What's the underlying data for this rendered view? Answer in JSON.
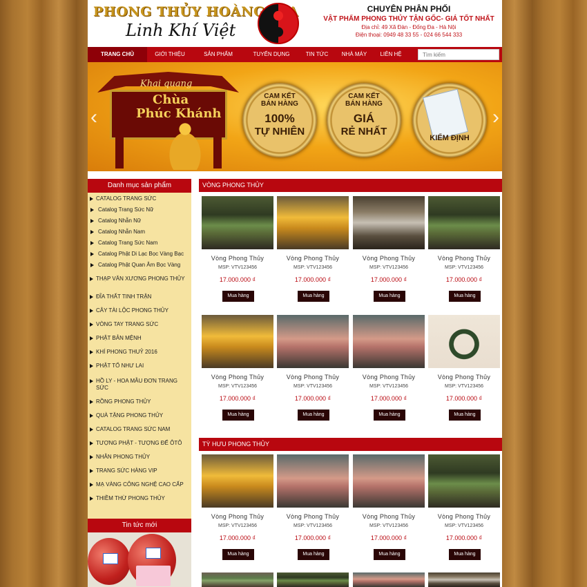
{
  "header": {
    "logo_main": "PHONG THỦY HOÀNG GIA",
    "logo_sub": "Linh Khí Việt",
    "title": "CHUYÊN PHÂN PHỐI",
    "slogan": "VẬT PHẨM PHONG THỦY TẬN GỐC- GIÁ TỐT NHẤT",
    "address": "Địa chỉ: 49 Xã Đàn - Đống Đa - Hà Nội",
    "phone": "Điện thoại: 0949 48 33 55 - 024 66 544 333"
  },
  "nav": {
    "items": [
      {
        "label": "TRANG CHỦ"
      },
      {
        "label": "GIỚI THIỆU"
      },
      {
        "label": "SẢN PHẨM"
      },
      {
        "label": "TUYỂN DỤNG"
      },
      {
        "label": "TIN TỨC"
      },
      {
        "label": "NHÀ MÁY"
      },
      {
        "label": "LIÊN HỆ"
      }
    ],
    "search_placeholder": "Tìm kiếm"
  },
  "banner": {
    "title_1": "Khai quang",
    "title_2": "Chùa",
    "title_3": "Phúc Khánh",
    "medal_1": [
      "CAM KẾT",
      "BÁN HÀNG",
      "100%",
      "TỰ NHIÊN"
    ],
    "medal_2": [
      "CAM KẾT",
      "BÁN HÀNG",
      "GIÁ",
      "RẺ NHẤT"
    ],
    "medal_3": "KIỂM ĐỊNH",
    "prev": "‹",
    "next": "›"
  },
  "sidebar": {
    "heading": "Danh mục sản phẩm",
    "items": [
      {
        "label": "CATALOG TRANG SỨC",
        "level": "top"
      },
      {
        "label": "Catalog Trang Sức Nữ",
        "level": "sub"
      },
      {
        "label": "Catalog Nhẫn Nữ",
        "level": "sub"
      },
      {
        "label": "Catalog Nhẫn Nam",
        "level": "sub"
      },
      {
        "label": "Catalog Trang Sức Nam",
        "level": "sub"
      },
      {
        "label": "Catalog Phật Di Lạc Bọc Vàng Bạc",
        "level": "sub"
      },
      {
        "label": "Catalog Phật Quan Âm Bọc Vàng",
        "level": "sub"
      },
      {
        "label": "THẠP VĂN XƯƠNG PHONG THỦY",
        "level": "top"
      },
      {
        "label": "ĐĨA THẤT TINH TRẬN",
        "level": "top"
      },
      {
        "label": "CÂY TÀI LỘC PHONG THỦY",
        "level": "top"
      },
      {
        "label": "VÒNG TAY TRANG SỨC",
        "level": "top"
      },
      {
        "label": "PHẬT BẢN MỆNH",
        "level": "top"
      },
      {
        "label": "KHÍ PHONG THUỶ 2016",
        "level": "top"
      },
      {
        "label": "PHẬT TỔ NHƯ LAI",
        "level": "top"
      },
      {
        "label": "HỒ LY - HOA MẪU ĐƠN TRANG SỨC",
        "level": "top"
      },
      {
        "label": "RỒNG PHONG THỦY",
        "level": "top"
      },
      {
        "label": "QUÀ TẶNG PHONG THỦY",
        "level": "top"
      },
      {
        "label": "Catalog Trang Sức Nam",
        "level": "top"
      },
      {
        "label": "TƯỢNG PHẬT - TƯỢNG ĐỂ ÔTÔ",
        "level": "top"
      },
      {
        "label": "NHẪN PHONG THỦY",
        "level": "top"
      },
      {
        "label": "TRANG SỨC HÀNG VIP",
        "level": "top"
      },
      {
        "label": "MẠ VÀNG CÔNG NGHỆ CAO CẤP",
        "level": "top"
      },
      {
        "label": "THIỀM THỪ PHONG THỦY",
        "level": "top"
      }
    ],
    "news_heading": "Tin tức mới"
  },
  "sections": [
    {
      "title": "VÒNG PHONG THỦY",
      "products": [
        {
          "name": "Vòng Phong Thủy",
          "code": "MSP: VTV123456",
          "price": "17.000.000 ₫",
          "button": "Mua hàng",
          "image": "jade-dragon"
        },
        {
          "name": "Vòng Phong Thủy",
          "code": "MSP: VTV123456",
          "price": "17.000.000 ₫",
          "button": "Mua hàng",
          "image": "gold-statue"
        },
        {
          "name": "Vòng Phong Thủy",
          "code": "MSP: VTV123456",
          "price": "17.000.000 ₫",
          "button": "Mua hàng",
          "image": "shelf-certificate"
        },
        {
          "name": "Vòng Phong Thủy",
          "code": "MSP: VTV123456",
          "price": "17.000.000 ₫",
          "button": "Mua hàng",
          "image": "jade-dragon"
        },
        {
          "name": "Vòng Phong Thủy",
          "code": "MSP: VTV123456",
          "price": "17.000.000 ₫",
          "button": "Mua hàng",
          "image": "gold-statue"
        },
        {
          "name": "Vòng Phong Thủy",
          "code": "MSP: VTV123456",
          "price": "17.000.000 ₫",
          "button": "Mua hàng",
          "image": "rose-quartz"
        },
        {
          "name": "Vòng Phong Thủy",
          "code": "MSP: VTV123456",
          "price": "17.000.000 ₫",
          "button": "Mua hàng",
          "image": "rose-quartz"
        },
        {
          "name": "Vòng Phong Thủy",
          "code": "MSP: VTV123456",
          "price": "17.000.000 ₫",
          "button": "Mua hàng",
          "image": "bracelet"
        }
      ]
    },
    {
      "title": "TỲ HƯU PHONG THỦY",
      "products": [
        {
          "name": "Vòng Phong Thủy",
          "code": "MSP: VTV123456",
          "price": "17.000.000 ₫",
          "button": "Mua hàng",
          "image": "gold-statue"
        },
        {
          "name": "Vòng Phong Thủy",
          "code": "MSP: VTV123456",
          "price": "17.000.000 ₫",
          "button": "Mua hàng",
          "image": "rose-quartz"
        },
        {
          "name": "Vòng Phong Thủy",
          "code": "MSP: VTV123456",
          "price": "17.000.000 ₫",
          "button": "Mua hàng",
          "image": "rose-quartz"
        },
        {
          "name": "Vòng Phong Thủy",
          "code": "MSP: VTV123456",
          "price": "17.000.000 ₫",
          "button": "Mua hàng",
          "image": "jade-dragon"
        }
      ]
    }
  ]
}
